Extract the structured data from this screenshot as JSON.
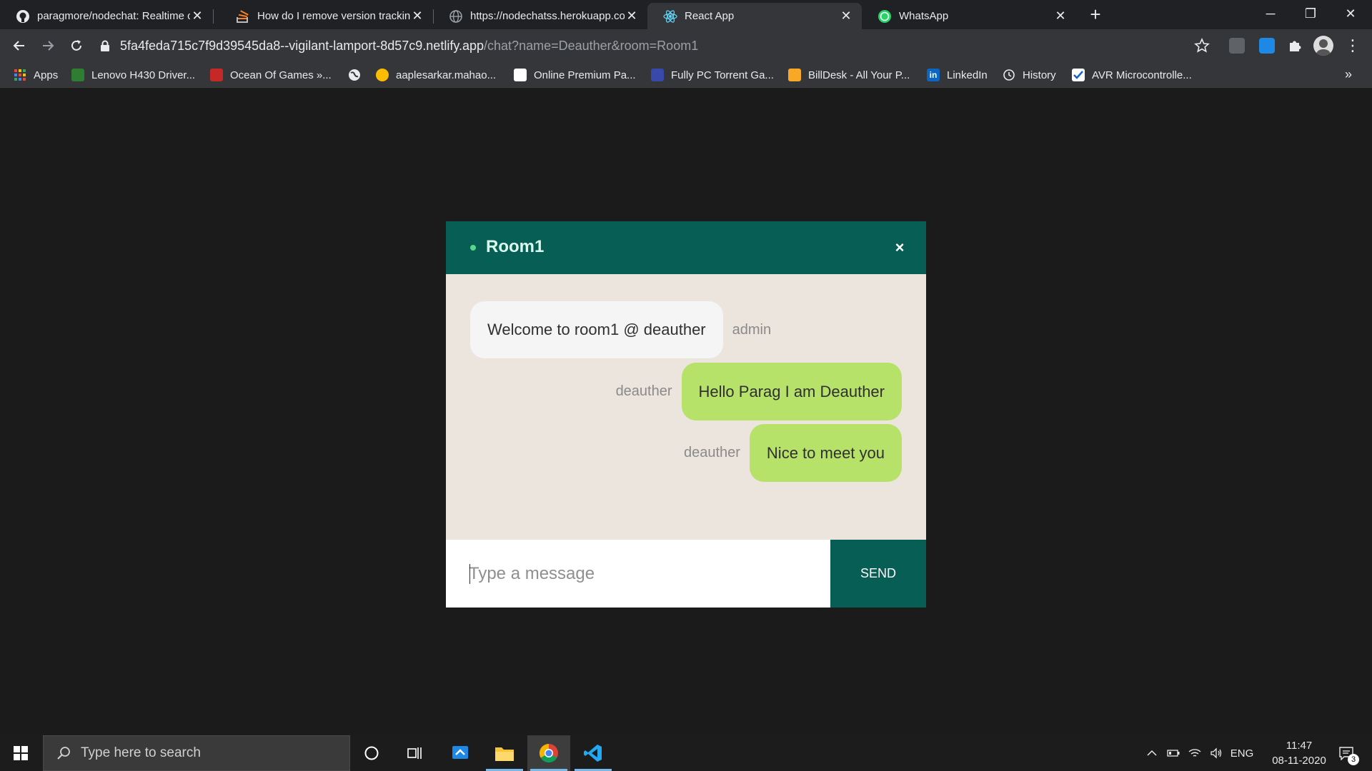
{
  "browser": {
    "tabs": [
      {
        "title": "paragmore/nodechat: Realtime ch",
        "icon": "github-icon"
      },
      {
        "title": "How do I remove version tracking",
        "icon": "stackoverflow-icon"
      },
      {
        "title": "https://nodechatss.herokuapp.com",
        "icon": "globe-icon"
      },
      {
        "title": "React App",
        "icon": "react-icon",
        "active": true
      },
      {
        "title": "WhatsApp",
        "icon": "whatsapp-icon"
      }
    ],
    "url_host": "5fa4feda715c7f9d39545da8--vigilant-lamport-8d57c9.netlify.app",
    "url_path": "/chat?name=Deauther&room=Room1",
    "bookmarks": [
      {
        "label": "Apps"
      },
      {
        "label": "Lenovo H430 Driver..."
      },
      {
        "label": "Ocean Of Games »..."
      },
      {
        "label": ""
      },
      {
        "label": "aaplesarkar.mahao..."
      },
      {
        "label": "Online Premium Pa..."
      },
      {
        "label": "Fully PC Torrent Ga..."
      },
      {
        "label": "BillDesk - All Your P..."
      },
      {
        "label": "LinkedIn"
      },
      {
        "label": "History"
      },
      {
        "label": "AVR Microcontrolle..."
      }
    ],
    "more_bookmarks": "»"
  },
  "chat": {
    "room": "Room1",
    "close_label": "×",
    "messages": [
      {
        "text": "Welcome to room1 @ deauther",
        "sender": "admin",
        "direction": "in"
      },
      {
        "text": "Hello Parag I am Deauther",
        "sender": "deauther",
        "direction": "out"
      },
      {
        "text": "Nice to meet you",
        "sender": "deauther",
        "direction": "out"
      }
    ],
    "input_placeholder": "Type a message",
    "send_label": "SEND",
    "colors": {
      "header": "#075e54",
      "background": "#ece5dd",
      "outgoing": "#b7e26a",
      "incoming": "#f5f5f5"
    }
  },
  "taskbar": {
    "search_placeholder": "Type here to search",
    "language": "ENG",
    "time": "11:47",
    "date": "08-11-2020",
    "notification_count": "3"
  }
}
